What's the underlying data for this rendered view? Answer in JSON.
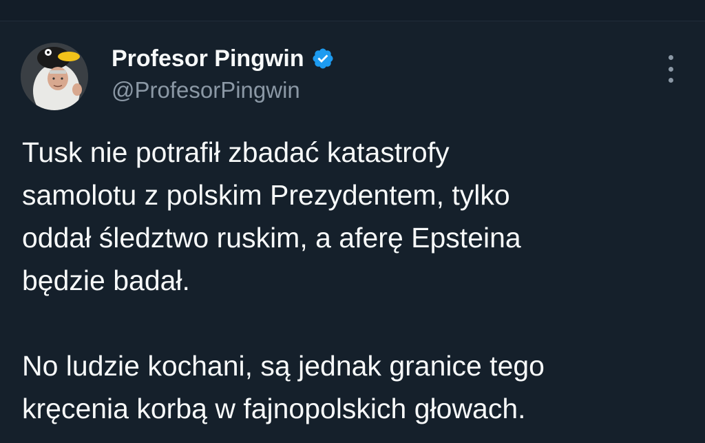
{
  "tweet": {
    "author": {
      "display_name": "Profesor Pingwin",
      "handle": "@ProfesorPingwin",
      "verified": true,
      "avatar_icon": "penguin-costume-avatar"
    },
    "more_icon": "more-vertical-icon",
    "paragraphs": [
      [
        "Tusk nie potrafił zbadać katastrofy",
        "samolotu z polskim Prezydentem, tylko",
        "oddał śledztwo ruskim, a aferę Epsteina",
        "będzie badał."
      ],
      [
        "No ludzie kochani, są jednak granice tego",
        "kręcenia korbą w fajnopolskich głowach."
      ]
    ]
  },
  "colors": {
    "background": "#15202b",
    "text": "#f7f9f9",
    "muted": "#8b98a5",
    "verified_blue": "#1d9bf0"
  }
}
